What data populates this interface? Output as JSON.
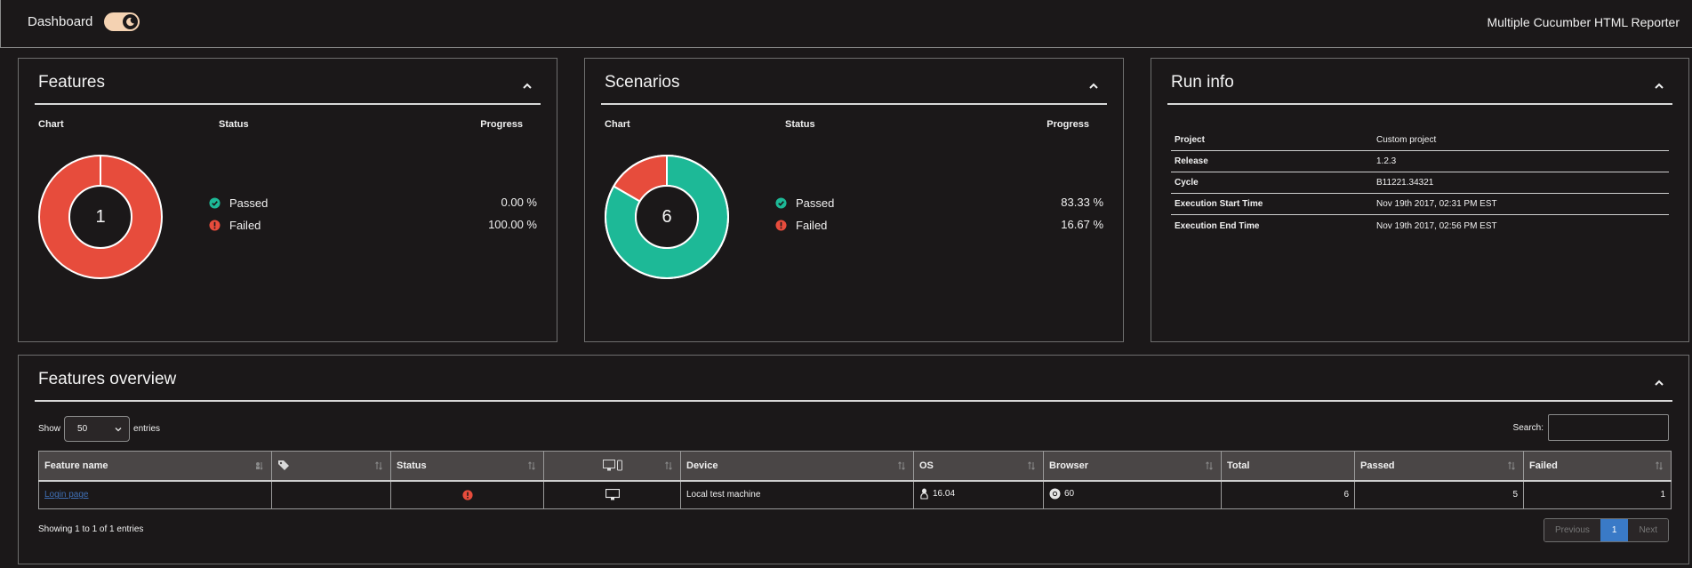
{
  "header": {
    "title": "Dashboard",
    "brand": "Multiple Cucumber HTML Reporter"
  },
  "colors": {
    "passed": "#1db997",
    "failed": "#e74c3c",
    "accent": "#3a7ac7"
  },
  "features_panel": {
    "title": "Features",
    "col_chart": "Chart",
    "col_status": "Status",
    "col_progress": "Progress",
    "total": "1",
    "legend": [
      {
        "label": "Passed",
        "pct": "0.00 %",
        "value": 0
      },
      {
        "label": "Failed",
        "pct": "100.00 %",
        "value": 1
      }
    ]
  },
  "scenarios_panel": {
    "title": "Scenarios",
    "col_chart": "Chart",
    "col_status": "Status",
    "col_progress": "Progress",
    "total": "6",
    "legend": [
      {
        "label": "Passed",
        "pct": "83.33 %",
        "value": 5
      },
      {
        "label": "Failed",
        "pct": "16.67 %",
        "value": 1
      }
    ]
  },
  "run_info": {
    "title": "Run info",
    "rows": [
      {
        "key": "Project",
        "value": "Custom project"
      },
      {
        "key": "Release",
        "value": "1.2.3"
      },
      {
        "key": "Cycle",
        "value": "B11221.34321"
      },
      {
        "key": "Execution Start Time",
        "value": "Nov 19th 2017, 02:31 PM EST"
      },
      {
        "key": "Execution End Time",
        "value": "Nov 19th 2017, 02:56 PM EST"
      }
    ]
  },
  "overview": {
    "title": "Features overview",
    "show_label": "Show",
    "entries_label": "entries",
    "page_size": "50",
    "search_label": "Search:",
    "columns": {
      "feature": "Feature name",
      "status": "Status",
      "device": "Device",
      "os": "OS",
      "browser": "Browser",
      "total": "Total",
      "passed": "Passed",
      "failed": "Failed"
    },
    "row": {
      "feature": "Login page",
      "device": "Local test machine",
      "os": "16.04",
      "browser": "60",
      "total": "6",
      "passed": "5",
      "failed": "1"
    },
    "showing": "Showing 1 to 1 of 1 entries",
    "pager": {
      "previous": "Previous",
      "page": "1",
      "next": "Next"
    }
  }
}
